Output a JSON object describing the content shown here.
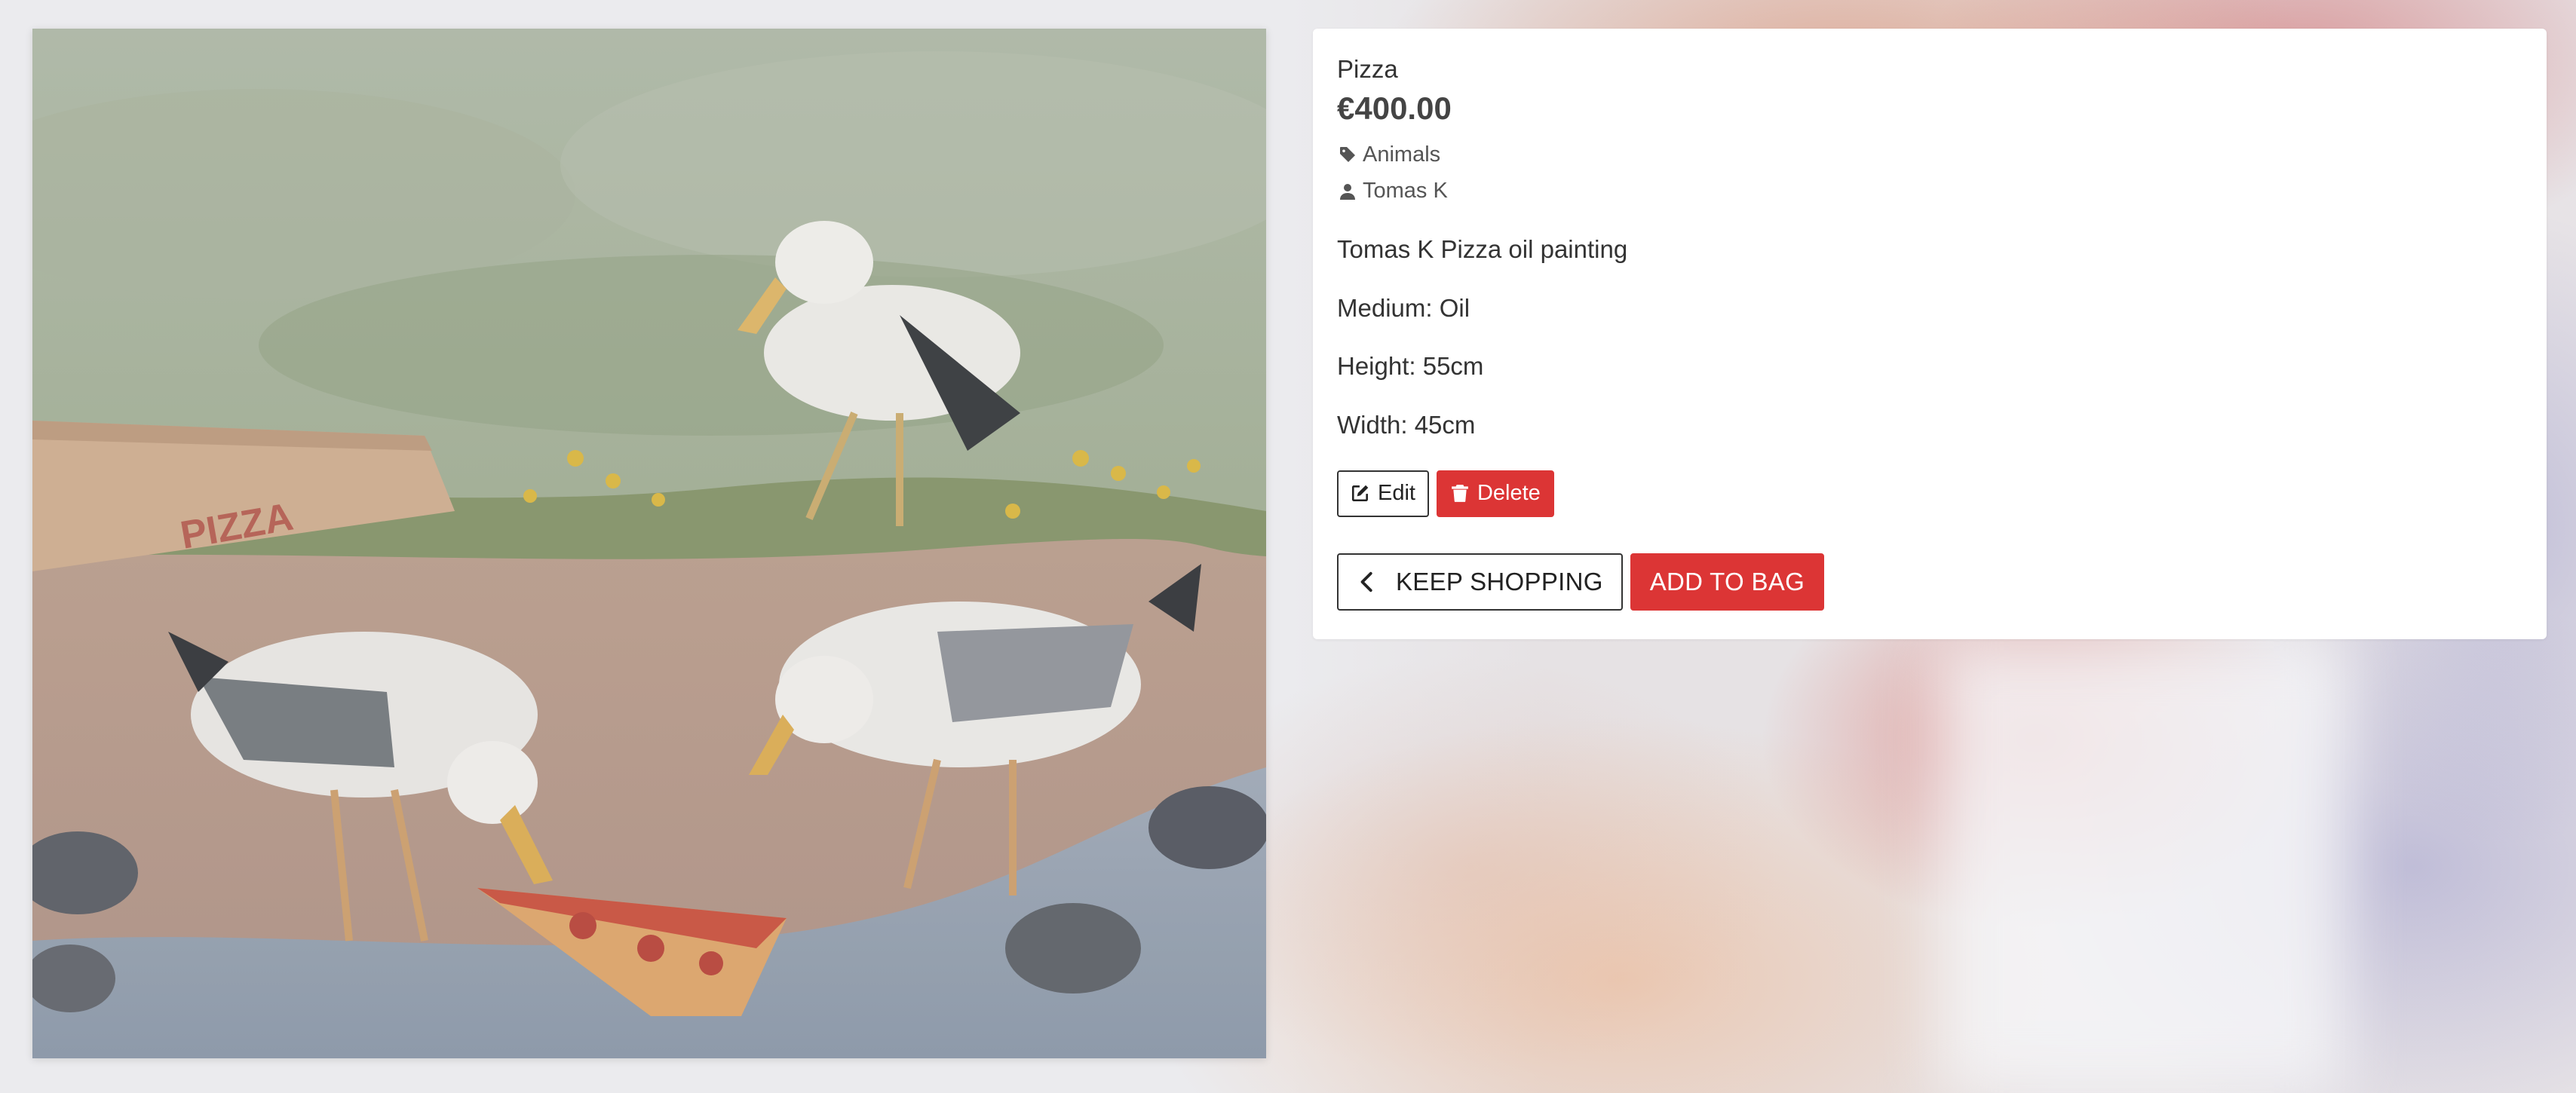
{
  "product": {
    "name": "Pizza",
    "price": "€400.00",
    "category": "Animals",
    "artist": "Tomas K",
    "description": "Tomas K Pizza oil painting",
    "medium": "Medium: Oil",
    "height": "Height: 55cm",
    "width": "Width: 45cm"
  },
  "artwork": {
    "box_text": "PIZZA"
  },
  "admin": {
    "edit_label": "Edit",
    "delete_label": "Delete"
  },
  "actions": {
    "keep_shopping_label": "KEEP SHOPPING",
    "add_to_bag_label": "ADD TO BAG"
  },
  "icons": {
    "category": "tag-icon",
    "artist": "user-icon",
    "edit": "edit-icon",
    "delete": "trash-icon",
    "keep_shopping": "chevron-left-icon"
  },
  "colors": {
    "accent": "#dc3535",
    "panel_bg": "#ffffff",
    "text": "#333333"
  }
}
